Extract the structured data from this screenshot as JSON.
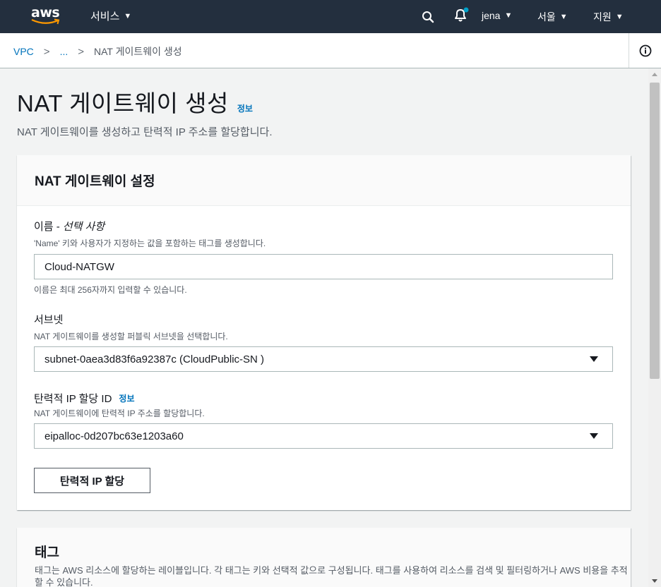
{
  "topnav": {
    "logo": "aws",
    "services": "서비스",
    "user": "jena",
    "region": "서울",
    "support": "지원",
    "colors": {
      "bg": "#232f3e",
      "notification_dot": "#00a1c9",
      "smile": "#ff9900"
    }
  },
  "breadcrumb": {
    "items": [
      "VPC",
      "...",
      "NAT 게이트웨이 생성"
    ]
  },
  "page": {
    "title": "NAT 게이트웨이 생성",
    "info": "정보",
    "description": "NAT 게이트웨이를 생성하고 탄력적 IP 주소를 할당합니다."
  },
  "settings": {
    "title": "NAT 게이트웨이 설정",
    "name": {
      "label": "이름 -",
      "label_optional": "선택 사항",
      "help": "'Name' 키와 사용자가 지정하는 값을 포함하는 태그를 생성합니다.",
      "value": "Cloud-NATGW",
      "constraint": "이름은 최대 256자까지 입력할 수 있습니다."
    },
    "subnet": {
      "label": "서브넷",
      "help": "NAT 게이트웨이를 생성할 퍼블릭 서브넷을 선택합니다.",
      "value": "subnet-0aea3d83f6a92387c (CloudPublic-SN )"
    },
    "eip": {
      "label": "탄력적 IP 할당 ID",
      "info": "정보",
      "help": "NAT 게이트웨이에 탄력적 IP 주소를 할당합니다.",
      "value": "eipalloc-0d207bc63e1203a60"
    },
    "allocate_button": "탄력적 IP 할당"
  },
  "tags": {
    "title": "태그",
    "description": "태그는 AWS 리소스에 할당하는 레이블입니다. 각 태그는 키와 선택적 값으로 구성됩니다. 태그를 사용하여 리소스를 검색 및 필터링하거나 AWS 비용을 추적할 수 있습니다."
  }
}
